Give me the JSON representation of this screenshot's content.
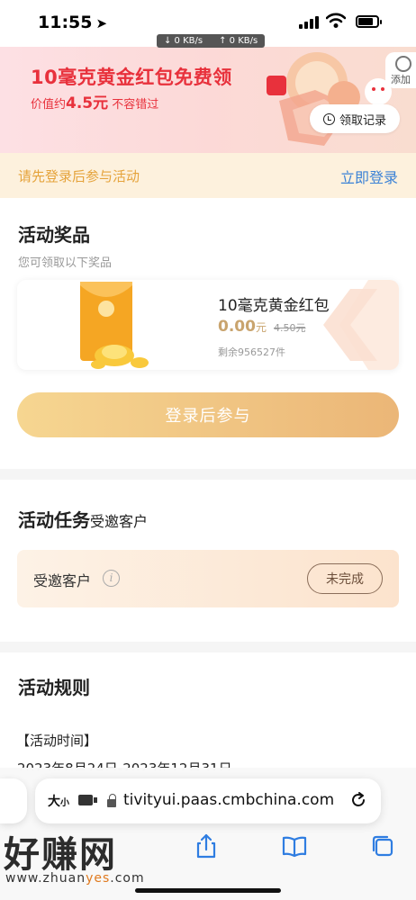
{
  "status_bar": {
    "time": "11:55",
    "net_down": "↓ 0 KB/s",
    "net_up": "↑ 0 KB/s"
  },
  "banner": {
    "title": "10毫克黄金红包免费领",
    "subtitle_prefix": "价值约",
    "subtitle_price": "4.5元",
    "subtitle_suffix": " 不容错过",
    "record_button": "领取记录",
    "add_tab_label": "添加"
  },
  "login_bar": {
    "hint": "请先登录后参与活动",
    "link": "立即登录"
  },
  "prizes": {
    "title": "活动奖品",
    "subtitle": "您可领取以下奖品",
    "item": {
      "name": "10毫克黄金红包",
      "price": "0.00",
      "price_unit": "元",
      "original_price": "4.50元",
      "stock": "剩余956527件"
    },
    "join_button": "登录后参与"
  },
  "tasks": {
    "title": "活动任务",
    "title_suffix": "受邀客户",
    "item": {
      "name": "受邀客户",
      "info_glyph": "i",
      "status": "未完成"
    }
  },
  "rules": {
    "title": "活动规则",
    "time_label": "【活动时间】",
    "time_value": "2023年8月24日-2023年12月31日"
  },
  "browser": {
    "aa_label": "大",
    "aa_small": "小",
    "url": "tivityui.paas.cmbchina.com"
  },
  "watermark": {
    "text": "好赚网",
    "url_prefix": "www.zhuan",
    "url_highlight": "yes",
    "url_suffix": ".com"
  },
  "colors": {
    "accent_red": "#e8313c",
    "gold": "#c9a46e",
    "link_blue": "#3b82d6",
    "hint_orange": "#e5a33b"
  }
}
